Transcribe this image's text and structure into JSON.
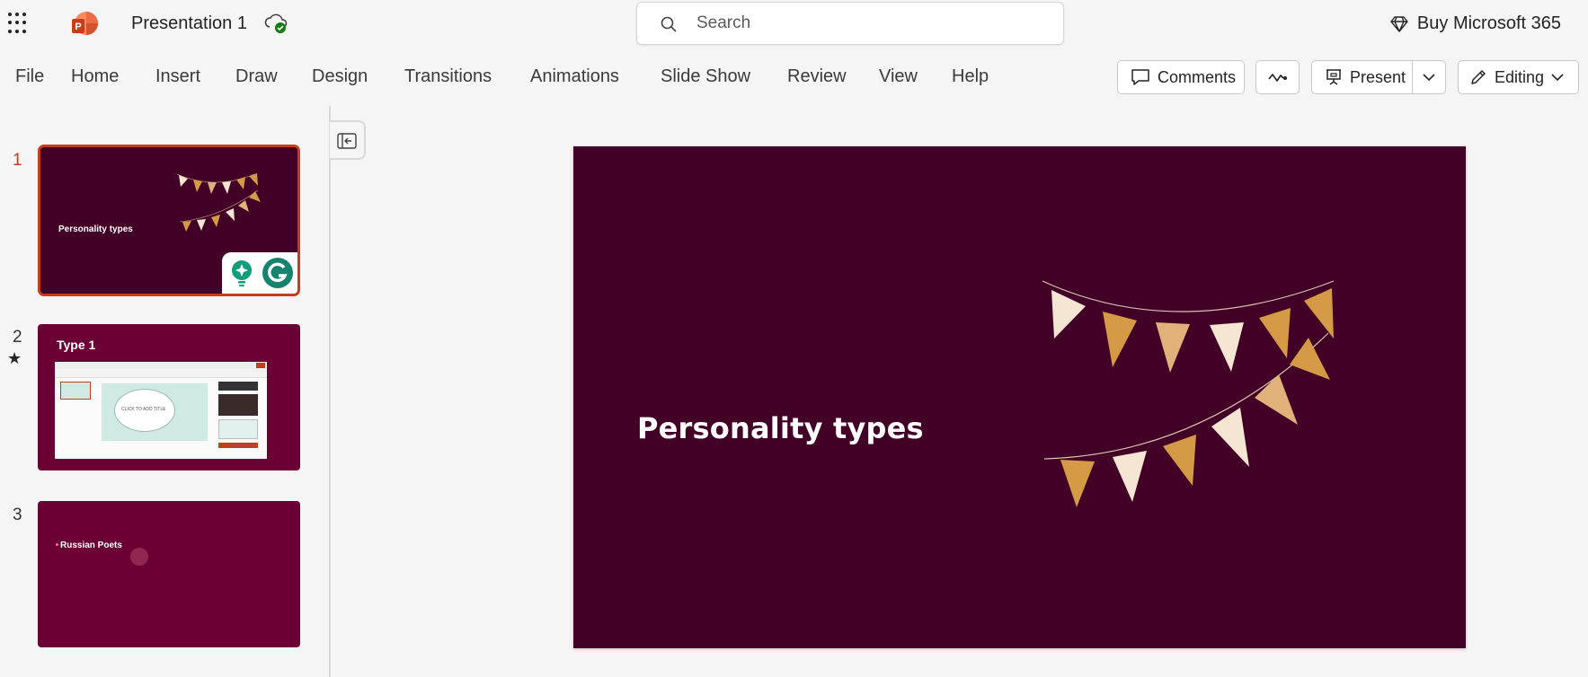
{
  "app": {
    "doc_title": "Presentation 1",
    "logo_letter": "P",
    "search_placeholder": "Search",
    "buy_label": "Buy Microsoft 365"
  },
  "ribbon": {
    "tabs": [
      "File",
      "Home",
      "Insert",
      "Draw",
      "Design",
      "Transitions",
      "Animations",
      "Slide Show",
      "Review",
      "View",
      "Help"
    ],
    "comments_label": "Comments",
    "present_label": "Present",
    "editing_label": "Editing"
  },
  "slides": [
    {
      "number": "1",
      "title": "Personality types",
      "selected": true
    },
    {
      "number": "2",
      "title": "Type 1",
      "star": "★",
      "inner_text": "CLICK TO ADD TITLE"
    },
    {
      "number": "3",
      "title": "Russian Poets"
    }
  ],
  "main_slide": {
    "title": "Personality types"
  },
  "colors": {
    "accent": "#c43e1c",
    "slide_bg": "#420026",
    "thumb_bg": "#6b0035",
    "flag_gold": "#d49a45",
    "flag_light": "#f5e6d3",
    "flag_tan": "#e0b27a"
  },
  "icons": {
    "waffle": "app-launcher-icon",
    "cloud": "cloud-saved-icon",
    "search": "search-icon",
    "diamond": "diamond-icon",
    "comments": "comment-icon",
    "catchup": "activity-icon",
    "present": "present-icon",
    "editing": "pencil-icon"
  }
}
